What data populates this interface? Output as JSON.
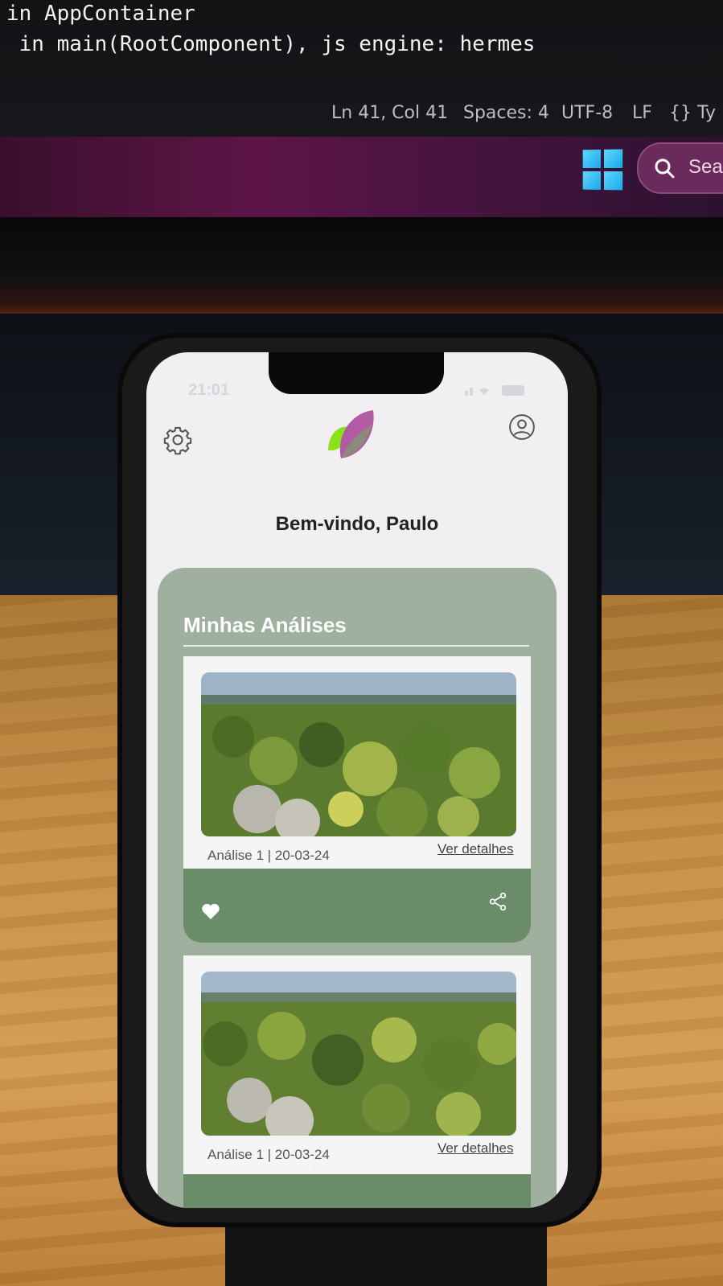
{
  "code_editor": {
    "lines": [
      "in AppContainer",
      " in main(RootComponent), js engine: hermes"
    ],
    "status_bar": {
      "position": "Ln 41, Col 41",
      "spaces": "Spaces: 4",
      "encoding": "UTF-8",
      "line_ending": "LF",
      "language": "{} Ty"
    }
  },
  "taskbar": {
    "search_label": "Sear",
    "accent": "#5d1547"
  },
  "phone": {
    "status_time": "21:01",
    "header": {
      "settings_icon": "gear-icon",
      "profile_icon": "user-circle-icon",
      "logo_icon": "leaf-icon"
    },
    "welcome": "Bem-vindo, Paulo",
    "section_title": "Minhas Análises",
    "cards": [
      {
        "meta": "Análise 1 | 20-03-24",
        "link": "Ver detalhes",
        "like_icon": "heart-icon",
        "share_icon": "share-icon"
      },
      {
        "meta": "Análise 1 | 20-03-24",
        "link": "Ver detalhes"
      }
    ],
    "colors": {
      "panel": "#9fb09f",
      "card_bar": "#6a8c68",
      "screen": "#f1eff2"
    }
  }
}
